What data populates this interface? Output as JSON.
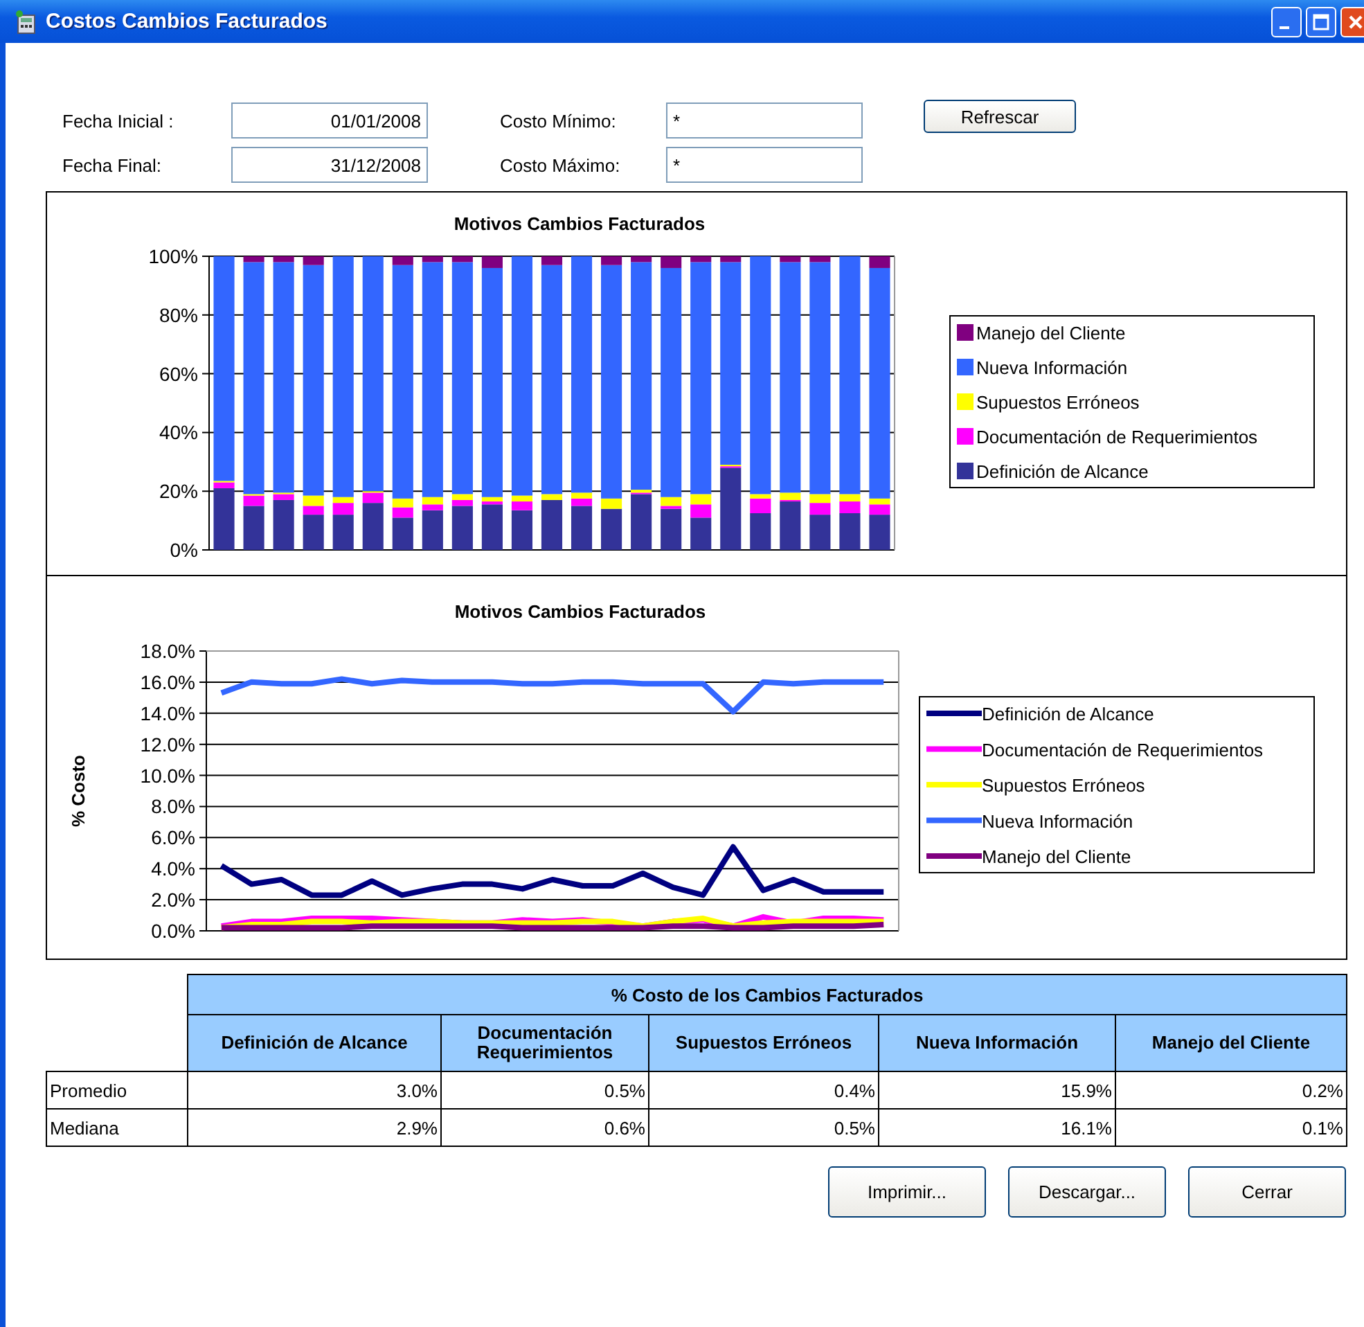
{
  "window": {
    "title": "Costos Cambios Facturados"
  },
  "filters": [
    {
      "label": "Fecha Inicial :",
      "value": "01/01/2008"
    },
    {
      "label": "Costo Mínimo:",
      "value": "*"
    },
    {
      "label": "Fecha Final:",
      "value": "31/12/2008"
    },
    {
      "label": "Costo Máximo:",
      "value": "*"
    }
  ],
  "refresh_button": "Refrescar",
  "charts": [
    {
      "chart_data": {
        "type": "bar",
        "stacked": true,
        "title": "Motivos Cambios Facturados",
        "ylim": [
          0,
          100
        ],
        "grid": "y",
        "legend": true,
        "yticks": [
          {
            "value": 0,
            "label": "0%"
          },
          {
            "value": 20,
            "label": "20%"
          },
          {
            "value": 40,
            "label": "40%"
          },
          {
            "value": 60,
            "label": "60%"
          },
          {
            "value": 80,
            "label": "80%"
          },
          {
            "value": 100,
            "label": "100%"
          }
        ],
        "series": [
          {
            "name": "Definición de Alcance",
            "color": "#333399",
            "values": [
              21,
              15,
              17,
              12,
              12,
              16,
              11,
              13.5,
              15,
              15.5,
              13.5,
              17,
              15,
              14,
              19,
              14,
              11,
              28,
              12.5,
              16.5,
              12,
              12.5,
              12
            ]
          },
          {
            "name": "Documentación de Requerimientos",
            "color": "#ff00ff",
            "values": [
              2,
              3.5,
              2,
              3,
              4,
              3.5,
              3.5,
              2,
              2,
              1,
              3,
              0,
              2.5,
              0,
              0.5,
              1,
              4.5,
              0.5,
              5,
              0.5,
              4,
              4,
              3.5
            ]
          },
          {
            "name": "Supuestos Erróneos",
            "color": "#ffff00",
            "values": [
              0.5,
              0.5,
              0.5,
              3.5,
              2,
              0.5,
              3,
              2.5,
              2,
              1.5,
              2,
              2,
              2,
              3.5,
              1,
              3,
              3.5,
              0.5,
              1.5,
              2.5,
              3,
              2.5,
              2
            ]
          },
          {
            "name": "Nueva Información",
            "color": "#3366ff",
            "values": [
              76.5,
              79,
              78.5,
              78.5,
              82,
              80,
              79.5,
              80,
              79,
              78,
              81.5,
              78,
              80.5,
              79.5,
              77.5,
              78,
              79,
              69,
              81,
              78.5,
              79,
              81,
              78.5
            ]
          },
          {
            "name": "Manejo del Cliente",
            "color": "#800080",
            "values": [
              0,
              2,
              2,
              3,
              0,
              0,
              3,
              2,
              2,
              4,
              0,
              3,
              0,
              3,
              2,
              4,
              2,
              2,
              0,
              2,
              2,
              0,
              4
            ]
          }
        ]
      }
    },
    {
      "chart_data": {
        "type": "line",
        "title": "Motivos Cambios Facturados",
        "ylabel": "% Costo",
        "ylim": [
          0,
          18
        ],
        "grid": "y",
        "legend": true,
        "yticks": [
          {
            "value": 0,
            "label": "0.0%"
          },
          {
            "value": 2,
            "label": "2.0%"
          },
          {
            "value": 4,
            "label": "4.0%"
          },
          {
            "value": 6,
            "label": "6.0%"
          },
          {
            "value": 8,
            "label": "8.0%"
          },
          {
            "value": 10,
            "label": "10.0%"
          },
          {
            "value": 12,
            "label": "12.0%"
          },
          {
            "value": 14,
            "label": "14.0%"
          },
          {
            "value": 16,
            "label": "16.0%"
          },
          {
            "value": 18,
            "label": "18.0%"
          }
        ],
        "series": [
          {
            "name": "Definición de Alcance",
            "color": "#000080",
            "values": [
              4.2,
              3.0,
              3.3,
              2.3,
              2.3,
              3.2,
              2.3,
              2.7,
              3.0,
              3.0,
              2.7,
              3.3,
              2.9,
              2.9,
              3.7,
              2.8,
              2.3,
              5.4,
              2.6,
              3.3,
              2.5,
              2.5,
              2.5
            ]
          },
          {
            "name": "Documentación de Requerimientos",
            "color": "#ff00ff",
            "values": [
              0.3,
              0.6,
              0.6,
              0.8,
              0.8,
              0.8,
              0.7,
              0.6,
              0.5,
              0.5,
              0.7,
              0.6,
              0.7,
              0.5,
              0.3,
              0.6,
              0.7,
              0.3,
              0.9,
              0.5,
              0.8,
              0.8,
              0.7
            ]
          },
          {
            "name": "Supuestos Erróneos",
            "color": "#ffff00",
            "values": [
              0.2,
              0.4,
              0.4,
              0.6,
              0.6,
              0.5,
              0.6,
              0.6,
              0.5,
              0.5,
              0.5,
              0.5,
              0.6,
              0.6,
              0.3,
              0.6,
              0.8,
              0.3,
              0.5,
              0.6,
              0.6,
              0.6,
              0.6
            ]
          },
          {
            "name": "Nueva Información",
            "color": "#3366ff",
            "values": [
              15.3,
              16.0,
              15.9,
              15.9,
              16.2,
              15.9,
              16.1,
              16.0,
              16.0,
              16.0,
              15.9,
              15.9,
              16.0,
              16.0,
              15.9,
              15.9,
              15.9,
              14.1,
              16.0,
              15.9,
              16.0,
              16.0,
              16.0
            ]
          },
          {
            "name": "Manejo del Cliente",
            "color": "#800080",
            "values": [
              0.2,
              0.2,
              0.2,
              0.2,
              0.2,
              0.3,
              0.3,
              0.3,
              0.3,
              0.3,
              0.2,
              0.2,
              0.2,
              0.2,
              0.2,
              0.3,
              0.3,
              0.2,
              0.2,
              0.3,
              0.3,
              0.3,
              0.4
            ]
          }
        ]
      }
    }
  ],
  "table": {
    "title": "% Costo de los Cambios Facturados",
    "columns": [
      "Definición de Alcance",
      "Documentación Requerimientos",
      "Supuestos Erróneos",
      "Nueva Información",
      "Manejo del Cliente"
    ],
    "rows": [
      {
        "label": "Promedio",
        "cells": [
          "3.0%",
          "0.5%",
          "0.4%",
          "15.9%",
          "0.2%"
        ]
      },
      {
        "label": "Mediana",
        "cells": [
          "2.9%",
          "0.6%",
          "0.5%",
          "16.1%",
          "0.1%"
        ]
      }
    ]
  },
  "buttons": [
    "Imprimir...",
    "Descargar...",
    "Cerrar"
  ]
}
